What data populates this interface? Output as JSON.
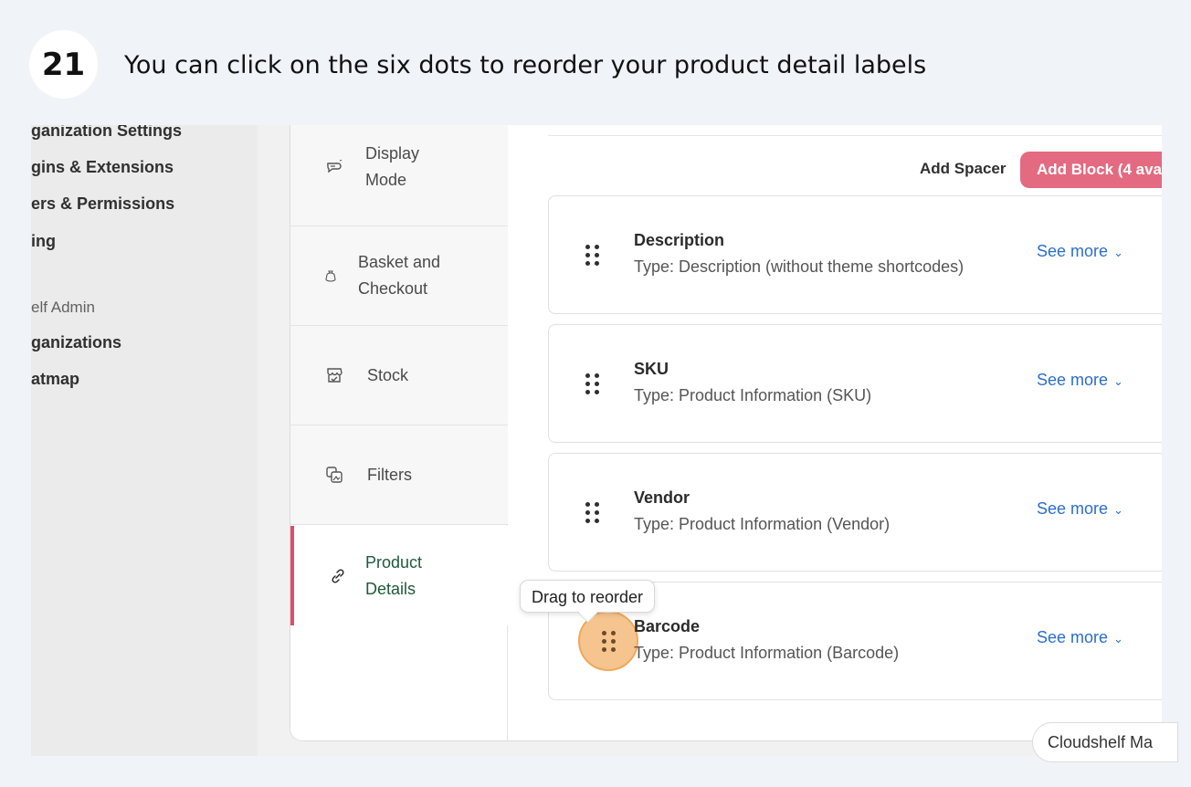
{
  "step": {
    "number": "21",
    "instruction": "You can click on the six dots to reorder your product detail labels"
  },
  "left_nav": {
    "items": [
      {
        "label": "ganization Settings"
      },
      {
        "label": "gins & Extensions"
      },
      {
        "label": "ers & Permissions"
      },
      {
        "label": "ing"
      }
    ],
    "section_label": "elf Admin",
    "section_items": [
      {
        "label": "ganizations"
      },
      {
        "label": "atmap"
      }
    ]
  },
  "tabs": [
    {
      "label_line1": "Display",
      "label_line2": "Mode",
      "icon": "display-mode-icon"
    },
    {
      "label_line1": "Basket and",
      "label_line2": "Checkout",
      "icon": "bag-icon"
    },
    {
      "label_line1": "Stock",
      "label_line2": "",
      "icon": "store-icon"
    },
    {
      "label_line1": "Filters",
      "label_line2": "",
      "icon": "filter-icon"
    },
    {
      "label_line1": "Product",
      "label_line2": "Details",
      "icon": "link-icon",
      "active": true
    }
  ],
  "toolbar": {
    "add_spacer": "Add Spacer",
    "add_block": "Add Block (4 ava"
  },
  "blocks": [
    {
      "title": "Description",
      "type": "Type: Description (without theme shortcodes)",
      "see_more": "See more"
    },
    {
      "title": "SKU",
      "type": "Type: Product Information (SKU)",
      "see_more": "See more"
    },
    {
      "title": "Vendor",
      "type": "Type: Product Information (Vendor)",
      "see_more": "See more"
    },
    {
      "title": "Barcode",
      "type": "Type: Product Information (Barcode)",
      "see_more": "See more"
    }
  ],
  "tooltip": "Drag to reorder",
  "footer_pill": "Cloudshelf Ma",
  "colors": {
    "accent": "#d9506b",
    "add_block_bg": "#e36a80",
    "link": "#2c6ecb",
    "active_tab_text": "#1f5a3a",
    "highlight": "#f6c48e"
  }
}
